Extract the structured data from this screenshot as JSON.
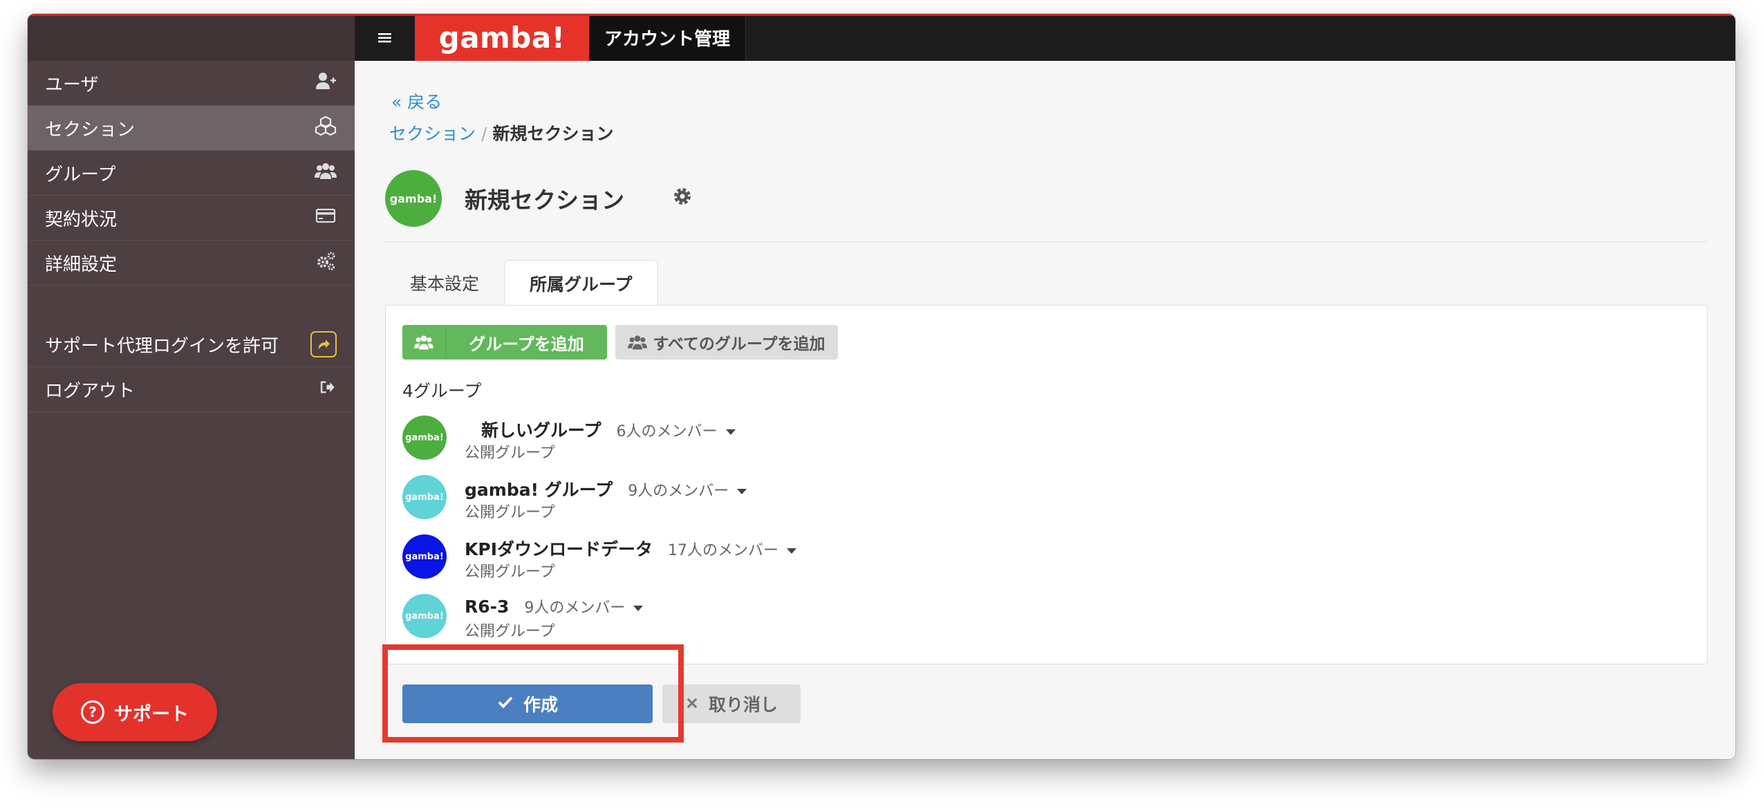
{
  "app": {
    "brand": "gamba!",
    "title": "アカウント管理",
    "menu_icon": "hamburger-icon"
  },
  "sidebar": {
    "items": [
      {
        "label": "ユーザ",
        "icon": "user-plus-icon"
      },
      {
        "label": "セクション",
        "icon": "cubes-icon",
        "active": true
      },
      {
        "label": "グループ",
        "icon": "users-icon"
      },
      {
        "label": "契約状況",
        "icon": "credit-card-icon"
      },
      {
        "label": "詳細設定",
        "icon": "gears-icon"
      }
    ],
    "bottom_items": [
      {
        "label": "サポート代理ログインを許可",
        "icon": "share-icon"
      },
      {
        "label": "ログアウト",
        "icon": "sign-out-icon"
      }
    ],
    "support_label": "サポート"
  },
  "main": {
    "back_label": "« 戻る",
    "breadcrumb": {
      "parent": "セクション",
      "separator": "/",
      "current": "新規セクション"
    },
    "section": {
      "avatar_text": "gamba!",
      "title": "新規セクション"
    },
    "tabs": [
      {
        "label": "基本設定",
        "active": false
      },
      {
        "label": "所属グループ",
        "active": true
      }
    ],
    "add_group_label": "グループを追加",
    "add_all_label": "すべてのグループを追加",
    "group_count": "4グループ",
    "groups": [
      {
        "name": "新しいグループ",
        "members": "6人のメンバー",
        "type": "公開グループ",
        "avatar_text": "gamba!",
        "color": "#4cae3e"
      },
      {
        "name": "gamba! グループ",
        "members": "9人のメンバー",
        "type": "公開グループ",
        "avatar_text": "gamba!",
        "color": "#5fd3d6"
      },
      {
        "name": "KPIダウンロードデータ",
        "members": "17人のメンバー",
        "type": "公開グループ",
        "avatar_text": "gamba!",
        "color": "#0a14e6"
      },
      {
        "name": "R6-3",
        "members": "9人のメンバー",
        "type": "公開グループ",
        "avatar_text": "gamba!",
        "color": "#5fd3d6"
      }
    ],
    "create_label": "作成",
    "cancel_label": "取り消し"
  },
  "colors": {
    "brand": "#e6332a",
    "sidebar": "#4d3f42",
    "primary": "#4b7fc0",
    "success": "#62b85a",
    "highlight": "#e33a2e"
  }
}
